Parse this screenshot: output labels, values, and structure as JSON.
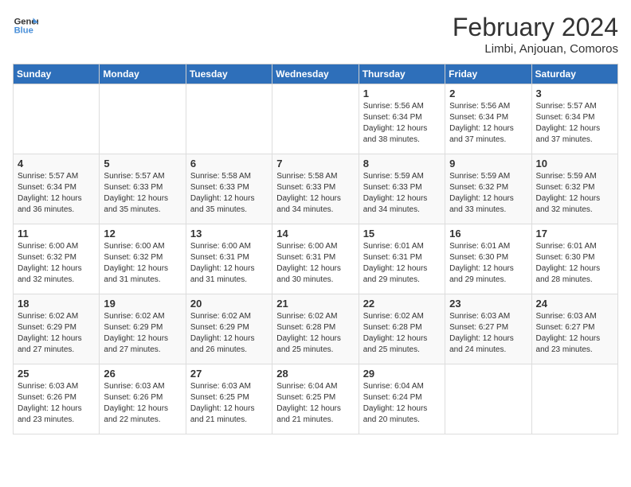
{
  "logo": {
    "line1": "General",
    "line2": "Blue"
  },
  "title": "February 2024",
  "subtitle": "Limbi, Anjouan, Comoros",
  "weekdays": [
    "Sunday",
    "Monday",
    "Tuesday",
    "Wednesday",
    "Thursday",
    "Friday",
    "Saturday"
  ],
  "weeks": [
    [
      {
        "day": "",
        "info": ""
      },
      {
        "day": "",
        "info": ""
      },
      {
        "day": "",
        "info": ""
      },
      {
        "day": "",
        "info": ""
      },
      {
        "day": "1",
        "info": "Sunrise: 5:56 AM\nSunset: 6:34 PM\nDaylight: 12 hours\nand 38 minutes."
      },
      {
        "day": "2",
        "info": "Sunrise: 5:56 AM\nSunset: 6:34 PM\nDaylight: 12 hours\nand 37 minutes."
      },
      {
        "day": "3",
        "info": "Sunrise: 5:57 AM\nSunset: 6:34 PM\nDaylight: 12 hours\nand 37 minutes."
      }
    ],
    [
      {
        "day": "4",
        "info": "Sunrise: 5:57 AM\nSunset: 6:34 PM\nDaylight: 12 hours\nand 36 minutes."
      },
      {
        "day": "5",
        "info": "Sunrise: 5:57 AM\nSunset: 6:33 PM\nDaylight: 12 hours\nand 35 minutes."
      },
      {
        "day": "6",
        "info": "Sunrise: 5:58 AM\nSunset: 6:33 PM\nDaylight: 12 hours\nand 35 minutes."
      },
      {
        "day": "7",
        "info": "Sunrise: 5:58 AM\nSunset: 6:33 PM\nDaylight: 12 hours\nand 34 minutes."
      },
      {
        "day": "8",
        "info": "Sunrise: 5:59 AM\nSunset: 6:33 PM\nDaylight: 12 hours\nand 34 minutes."
      },
      {
        "day": "9",
        "info": "Sunrise: 5:59 AM\nSunset: 6:32 PM\nDaylight: 12 hours\nand 33 minutes."
      },
      {
        "day": "10",
        "info": "Sunrise: 5:59 AM\nSunset: 6:32 PM\nDaylight: 12 hours\nand 32 minutes."
      }
    ],
    [
      {
        "day": "11",
        "info": "Sunrise: 6:00 AM\nSunset: 6:32 PM\nDaylight: 12 hours\nand 32 minutes."
      },
      {
        "day": "12",
        "info": "Sunrise: 6:00 AM\nSunset: 6:32 PM\nDaylight: 12 hours\nand 31 minutes."
      },
      {
        "day": "13",
        "info": "Sunrise: 6:00 AM\nSunset: 6:31 PM\nDaylight: 12 hours\nand 31 minutes."
      },
      {
        "day": "14",
        "info": "Sunrise: 6:00 AM\nSunset: 6:31 PM\nDaylight: 12 hours\nand 30 minutes."
      },
      {
        "day": "15",
        "info": "Sunrise: 6:01 AM\nSunset: 6:31 PM\nDaylight: 12 hours\nand 29 minutes."
      },
      {
        "day": "16",
        "info": "Sunrise: 6:01 AM\nSunset: 6:30 PM\nDaylight: 12 hours\nand 29 minutes."
      },
      {
        "day": "17",
        "info": "Sunrise: 6:01 AM\nSunset: 6:30 PM\nDaylight: 12 hours\nand 28 minutes."
      }
    ],
    [
      {
        "day": "18",
        "info": "Sunrise: 6:02 AM\nSunset: 6:29 PM\nDaylight: 12 hours\nand 27 minutes."
      },
      {
        "day": "19",
        "info": "Sunrise: 6:02 AM\nSunset: 6:29 PM\nDaylight: 12 hours\nand 27 minutes."
      },
      {
        "day": "20",
        "info": "Sunrise: 6:02 AM\nSunset: 6:29 PM\nDaylight: 12 hours\nand 26 minutes."
      },
      {
        "day": "21",
        "info": "Sunrise: 6:02 AM\nSunset: 6:28 PM\nDaylight: 12 hours\nand 25 minutes."
      },
      {
        "day": "22",
        "info": "Sunrise: 6:02 AM\nSunset: 6:28 PM\nDaylight: 12 hours\nand 25 minutes."
      },
      {
        "day": "23",
        "info": "Sunrise: 6:03 AM\nSunset: 6:27 PM\nDaylight: 12 hours\nand 24 minutes."
      },
      {
        "day": "24",
        "info": "Sunrise: 6:03 AM\nSunset: 6:27 PM\nDaylight: 12 hours\nand 23 minutes."
      }
    ],
    [
      {
        "day": "25",
        "info": "Sunrise: 6:03 AM\nSunset: 6:26 PM\nDaylight: 12 hours\nand 23 minutes."
      },
      {
        "day": "26",
        "info": "Sunrise: 6:03 AM\nSunset: 6:26 PM\nDaylight: 12 hours\nand 22 minutes."
      },
      {
        "day": "27",
        "info": "Sunrise: 6:03 AM\nSunset: 6:25 PM\nDaylight: 12 hours\nand 21 minutes."
      },
      {
        "day": "28",
        "info": "Sunrise: 6:04 AM\nSunset: 6:25 PM\nDaylight: 12 hours\nand 21 minutes."
      },
      {
        "day": "29",
        "info": "Sunrise: 6:04 AM\nSunset: 6:24 PM\nDaylight: 12 hours\nand 20 minutes."
      },
      {
        "day": "",
        "info": ""
      },
      {
        "day": "",
        "info": ""
      }
    ]
  ]
}
